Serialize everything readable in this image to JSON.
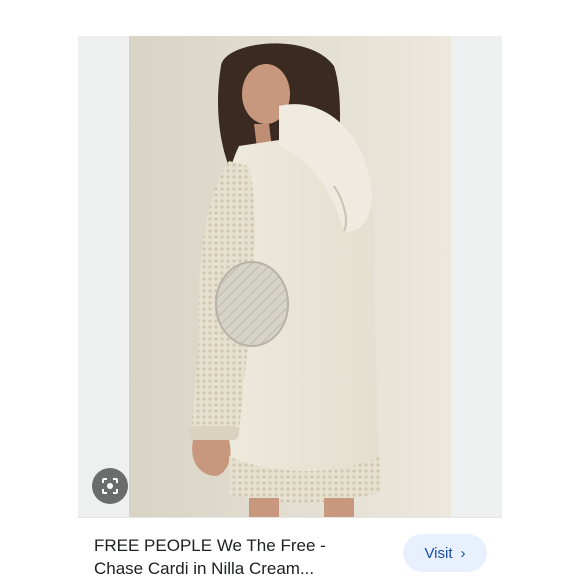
{
  "result": {
    "title": "FREE PEOPLE We The Free -\nChase Cardi in Nilla Cream...",
    "visit_label": "Visit",
    "visit_icon": "chevron-right-icon",
    "lens_icon": "google-lens-icon",
    "image_subject": "product-photo"
  },
  "colors": {
    "visit_bg": "#e8f0fe",
    "visit_text": "#1a4ea1",
    "title_text": "#202124",
    "frame_bg": "#eeefef"
  }
}
